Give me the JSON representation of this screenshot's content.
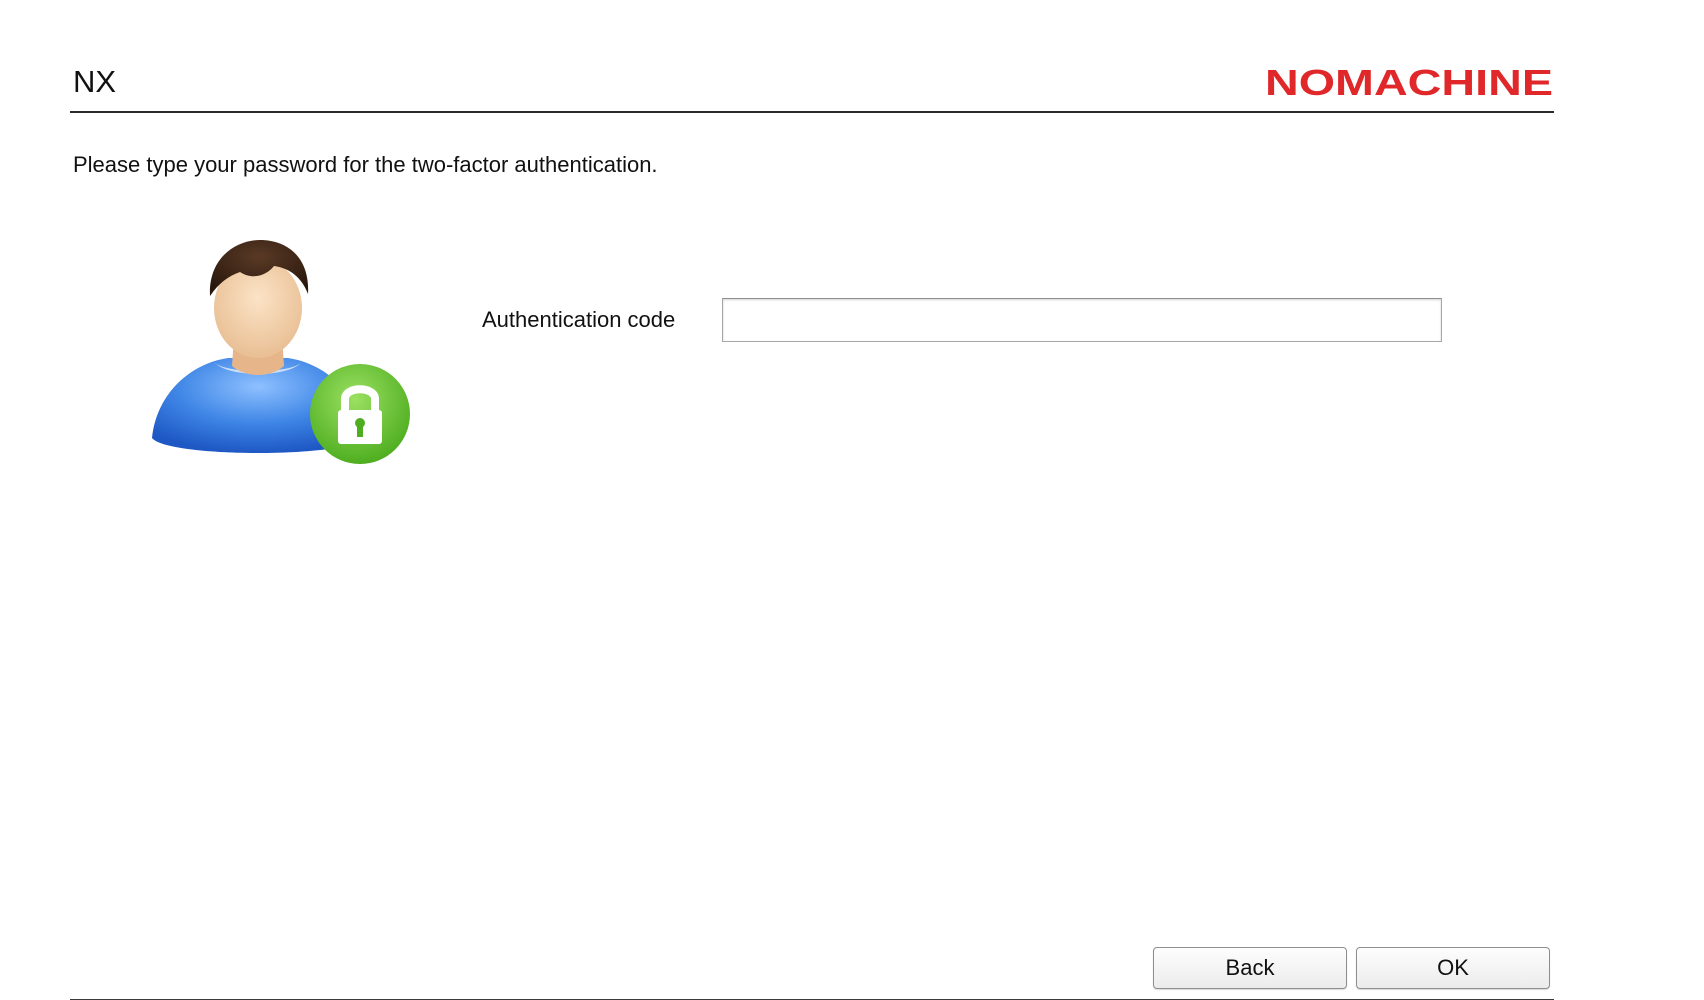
{
  "header": {
    "title": "NX",
    "brand_logo_text": "NOMACHINE",
    "brand_color": "#e0282b"
  },
  "prompt": {
    "instruction": "Please type your password for the two-factor authentication."
  },
  "form": {
    "auth_code_label": "Authentication code",
    "auth_code_value": "",
    "auth_code_placeholder": ""
  },
  "icons": {
    "avatar": "user-lock-icon",
    "lock_badge_color": "#6cc530",
    "shirt_color": "#2f74d8"
  },
  "footer": {
    "back_label": "Back",
    "ok_label": "OK"
  }
}
